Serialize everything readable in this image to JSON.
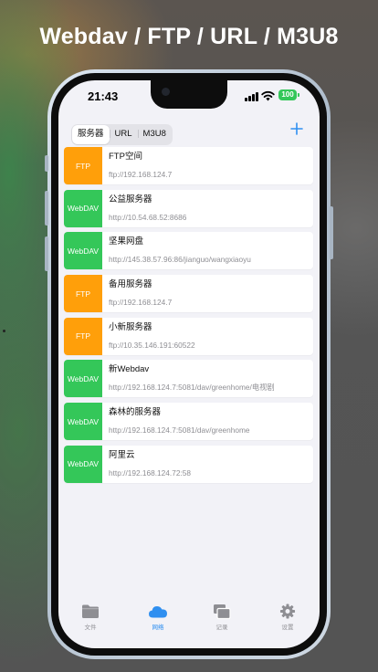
{
  "banner_title": "Webdav / FTP / URL / M3U8",
  "status_bar": {
    "time": "21:43",
    "battery": "100"
  },
  "segments": [
    {
      "label": "服务器",
      "selected": true
    },
    {
      "label": "URL",
      "selected": false
    },
    {
      "label": "M3U8",
      "selected": false
    }
  ],
  "colors": {
    "ftp": "#ff9f0a",
    "webdav": "#34c759",
    "accent": "#2f8ff0"
  },
  "servers": [
    {
      "type": "FTP",
      "name": "FTP空间",
      "url": "ftp://192.168.124.7"
    },
    {
      "type": "WebDAV",
      "name": "公益服务器",
      "url": "http://10.54.68.52:8686"
    },
    {
      "type": "WebDAV",
      "name": "坚果网盘",
      "url": "http://145.38.57.96:86/jianguo/wangxiaoyu"
    },
    {
      "type": "FTP",
      "name": "备用服务器",
      "url": "ftp://192.168.124.7"
    },
    {
      "type": "FTP",
      "name": "小新服务器",
      "url": "ftp://10.35.146.191:60522"
    },
    {
      "type": "WebDAV",
      "name": "新Webdav",
      "url": "http://192.168.124.7:5081/dav/greenhome/电视剧"
    },
    {
      "type": "WebDAV",
      "name": "森林的服务器",
      "url": "http://192.168.124.7:5081/dav/greenhome"
    },
    {
      "type": "WebDAV",
      "name": "阿里云",
      "url": "http://192.168.124.72:58"
    }
  ],
  "tabs": [
    {
      "label": "文件",
      "icon": "folder-icon",
      "active": false
    },
    {
      "label": "网络",
      "icon": "cloud-icon",
      "active": true
    },
    {
      "label": "记录",
      "icon": "history-icon",
      "active": false
    },
    {
      "label": "设置",
      "icon": "gear-icon",
      "active": false
    }
  ]
}
